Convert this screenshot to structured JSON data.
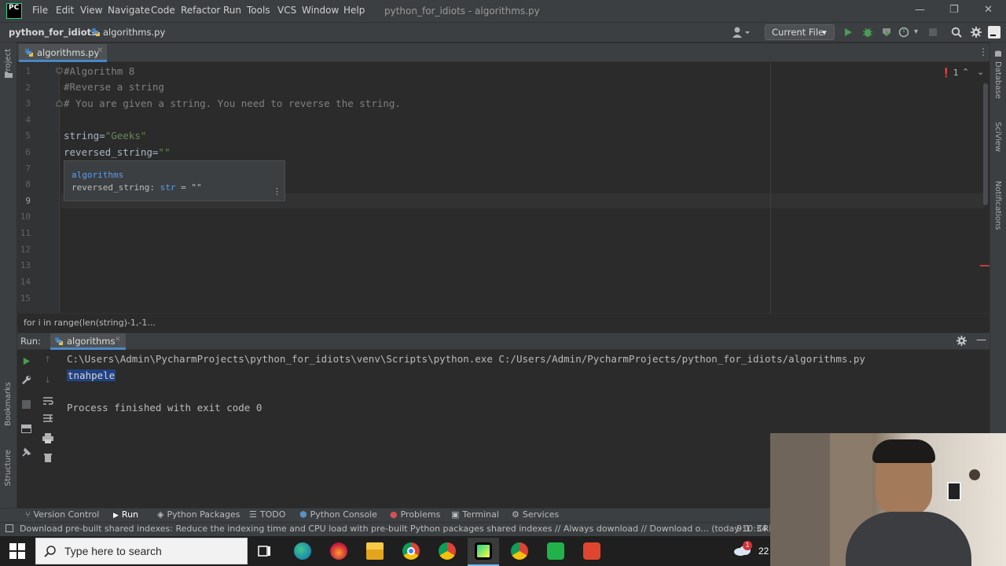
{
  "window": {
    "title": "python_for_idiots - algorithms.py",
    "logo": "PC",
    "menu": [
      "File",
      "Edit",
      "View",
      "Navigate",
      "Code",
      "Refactor",
      "Run",
      "Tools",
      "VCS",
      "Window",
      "Help"
    ],
    "controls": {
      "minimize": "—",
      "restore": "❐",
      "close": "✕"
    }
  },
  "navbar": {
    "project": "python_for_idiots",
    "file": "algorithms.py",
    "run_config": "Current File",
    "icons": [
      "user-icon",
      "run-icon",
      "debug-icon",
      "coverage-icon",
      "profile-icon",
      "stop-icon",
      "search-icon",
      "settings-icon",
      "jetbrains-icon"
    ]
  },
  "editor": {
    "tab_label": "algorithms.py",
    "line_numbers": [
      "1",
      "2",
      "3",
      "4",
      "5",
      "6",
      "7",
      "8",
      "9",
      "10",
      "11",
      "12",
      "13",
      "14",
      "15"
    ],
    "lines": {
      "l1": "#Algorithm 8",
      "l2": "#Reverse a string",
      "l3": "# You are given a string. You need to reverse the string.",
      "l5_ident": "string=",
      "l5_str": "\"Geeks\"",
      "l6_ident": "reversed_string=",
      "l6_str": "\"\""
    },
    "popup": {
      "module": "algorithms",
      "signature_name": "reversed_string: ",
      "signature_type": "str",
      "signature_value": " = \"\""
    },
    "problems_count": "1",
    "breadcrumb": "for i in range(len(string)-1,-1..."
  },
  "left_strip": [
    "Project",
    "Bookmarks",
    "Structure"
  ],
  "right_strip": [
    "Database",
    "SciView",
    "Notifications"
  ],
  "run_panel": {
    "label": "Run:",
    "tab": "algorithms",
    "command": "C:\\Users\\Admin\\PycharmProjects\\python_for_idiots\\venv\\Scripts\\python.exe C:/Users/Admin/PycharmProjects/python_for_idiots/algorithms.py",
    "result": "tnahpele",
    "exit": "Process finished with exit code 0"
  },
  "tool_windows": [
    "Version Control",
    "Run",
    "Python Packages",
    "TODO",
    "Python Console",
    "Problems",
    "Terminal",
    "Services"
  ],
  "status": {
    "message": "Download pre-built shared indexes: Reduce the indexing time and CPU load with pre-built Python packages shared indexes // Always download // Download o... (today 10:34 AM)",
    "position": "9:1",
    "line_sep": "CRL"
  },
  "taskbar": {
    "search_placeholder": "Type here to search",
    "weather_temp": "22",
    "apps": [
      "task-view-icon",
      "edge-icon",
      "firefox-icon",
      "file-explorer-icon",
      "chrome-icon",
      "chrome-beta-icon",
      "pycharm-icon",
      "chrome-alt-icon",
      "app-green-icon",
      "app-red-icon"
    ]
  },
  "colors": {
    "accent": "#4a88c7",
    "run_green": "#499c54",
    "error_red": "#d25252",
    "selection": "#214283"
  }
}
